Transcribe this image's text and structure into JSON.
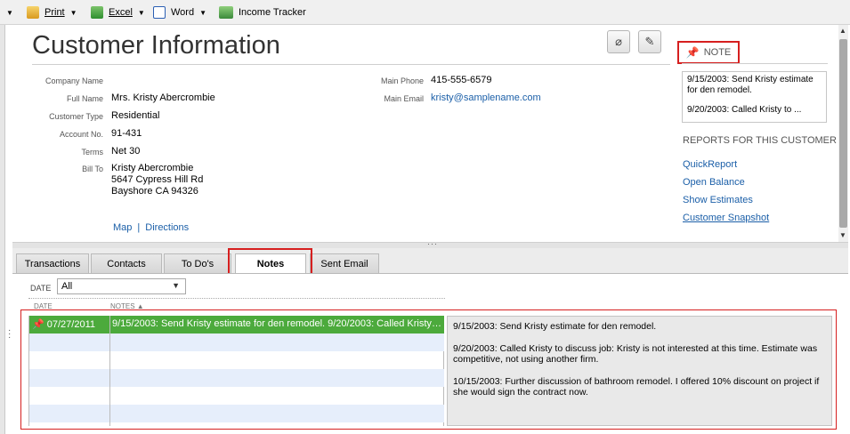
{
  "toolbar": {
    "print": "Print",
    "excel": "Excel",
    "word": "Word",
    "income_tracker": "Income Tracker"
  },
  "header": {
    "title": "Customer Information",
    "attach_icon": "paperclip-icon",
    "edit_icon": "pencil-icon"
  },
  "fields": {
    "company_name_label": "Company Name",
    "full_name_label": "Full Name",
    "full_name": "Mrs. Kristy Abercrombie",
    "customer_type_label": "Customer Type",
    "customer_type": "Residential",
    "account_no_label": "Account No.",
    "account_no": "91-431",
    "terms_label": "Terms",
    "terms": "Net 30",
    "bill_to_label": "Bill To",
    "bill_to": [
      "Kristy Abercrombie",
      "5647 Cypress Hill Rd",
      "Bayshore CA 94326"
    ],
    "main_phone_label": "Main Phone",
    "main_phone": "415-555-6579",
    "main_email_label": "Main Email",
    "main_email": "kristy@samplename.com",
    "map": "Map",
    "directions": "Directions"
  },
  "note_panel": {
    "header": "NOTE",
    "line1": "9/15/2003:  Send Kristy estimate for den remodel.",
    "line2": "9/20/2003:  Called Kristy to ..."
  },
  "reports": {
    "header": "REPORTS FOR THIS CUSTOMER",
    "links": [
      "QuickReport",
      "Open Balance",
      "Show Estimates",
      "Customer Snapshot"
    ]
  },
  "tabs": [
    "Transactions",
    "Contacts",
    "To Do's",
    "Notes",
    "Sent Email"
  ],
  "active_tab": "Notes",
  "filter": {
    "label": "DATE",
    "value": "All"
  },
  "columns": {
    "date": "DATE",
    "notes": "NOTES"
  },
  "notes_rows": [
    {
      "date": "07/27/2011",
      "note": "9/15/2003: Send Kristy estimate for den remodel. 9/20/2003: Called Kristy t..."
    }
  ],
  "note_detail": {
    "p1": "9/15/2003:  Send Kristy estimate for den remodel.",
    "p2": "9/20/2003:  Called Kristy to discuss job:  Kristy is not interested at this time. Estimate was competitive, not using another firm.",
    "p3": "10/15/2003:  Further discussion of bathroom remodel.  I offered 10% discount on project if she would sign the contract now."
  },
  "colors": {
    "selected_row": "#4caa3c",
    "highlight": "#d61f1f",
    "link": "#1b5fa8"
  }
}
